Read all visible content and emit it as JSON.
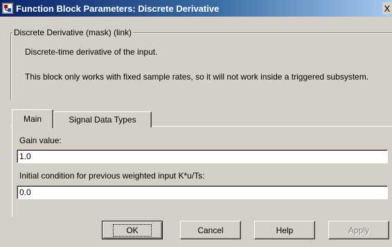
{
  "window": {
    "title": "Function Block Parameters: Discrete Derivative",
    "close_glyph": "X"
  },
  "mask": {
    "group_title": "Discrete Derivative (mask) (link)",
    "description_line1": "Discrete-time derivative of the input.",
    "description_line2": "This block only works with fixed sample rates, so it will not work inside a triggered subsystem."
  },
  "tabs": [
    {
      "label": "Main",
      "active": true
    },
    {
      "label": "Signal Data Types",
      "active": false
    }
  ],
  "params": {
    "gain_label": "Gain value:",
    "gain_value": "1.0",
    "ic_label": "Initial condition for previous weighted input K*u/Ts:",
    "ic_value": "0.0"
  },
  "buttons": {
    "ok": "OK",
    "cancel": "Cancel",
    "help": "Help",
    "apply": "Apply"
  },
  "colors": {
    "title_gradient_start": "#0a246a",
    "title_gradient_end": "#a6caf0",
    "face": "#d4d0c8",
    "disabled_text": "#808080"
  },
  "icons": {
    "title": "simulink-block-icon",
    "close": "close-icon"
  }
}
